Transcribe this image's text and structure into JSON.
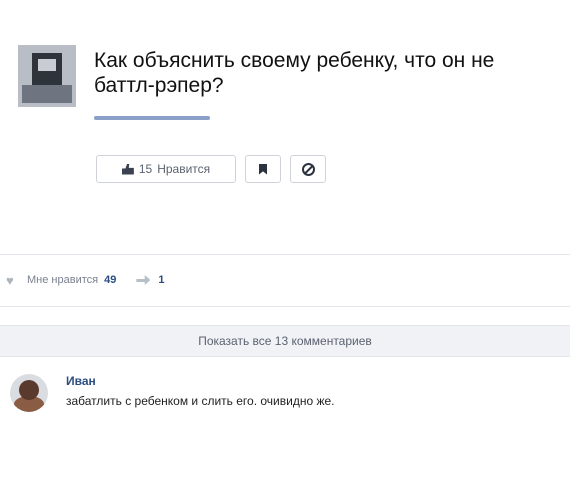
{
  "post": {
    "question": "Как объяснить своему ребенку, что он не баттл-рэпер?",
    "like_button_count": "15",
    "like_button_label": "Нравится"
  },
  "stats": {
    "likes_label": "Мне нравится",
    "likes_count": "49",
    "shares_count": "1"
  },
  "comments": {
    "show_all_label": "Показать все 13 комментариев",
    "items": [
      {
        "author": "Иван",
        "text": "забатлить с ребенком и слить его. очивидно же."
      }
    ]
  },
  "icons": {
    "like": "thumbs-up-icon",
    "flag": "flag-icon",
    "block": "block-icon",
    "heart": "heart-icon",
    "share": "share-icon"
  },
  "colors": {
    "link": "#2b4c80",
    "button_border": "#cfd3d9",
    "panel_bg": "#f0f2f5"
  }
}
